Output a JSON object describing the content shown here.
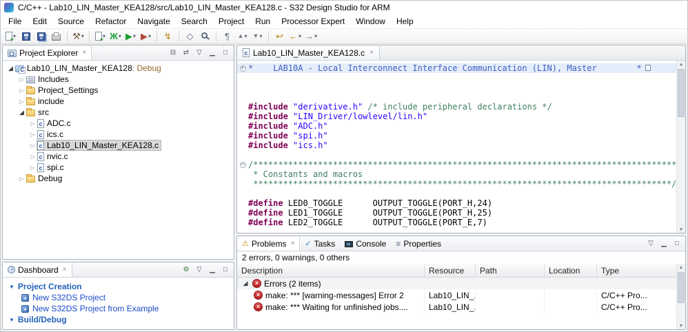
{
  "titlebar": {
    "title": "C/C++ - Lab10_LIN_Master_KEA128/src/Lab10_LIN_Master_KEA128.c - S32 Design Studio for ARM"
  },
  "menu": {
    "items": [
      "File",
      "Edit",
      "Source",
      "Refactor",
      "Navigate",
      "Search",
      "Project",
      "Run",
      "Processor Expert",
      "Window",
      "Help"
    ]
  },
  "icons": {
    "dropdown": "▾",
    "build": "⚒",
    "debug": "Ж",
    "run": "▶",
    "external_tools": "▶",
    "flash": "↯",
    "open_type": "◇",
    "paragraph": "¶",
    "prev_annotation": "▲",
    "next_annotation": "▼",
    "last_edit": "↩",
    "back": "←",
    "forward": "→",
    "collapse_all": "⊟",
    "link_editor": "⇄",
    "view_menu": "▽",
    "minimize": "▁",
    "maximize": "□",
    "close": "×",
    "gear": "⚙",
    "section_arrow": "▼",
    "tree_expanded": "◢",
    "tree_collapsed": "▷",
    "tasks": "✓",
    "properties": "≡",
    "problems": "⚠",
    "error_x": "×",
    "fold_plus": "+",
    "fold_minus": "−",
    "scroll_up": "▲",
    "scroll_down": "▼"
  },
  "explorer": {
    "tab": "Project Explorer",
    "root_name": "Lab10_LIN_Master_KEA128",
    "root_config": ": Debug",
    "nodes": {
      "includes": "Includes",
      "project_settings": "Project_Settings",
      "include": "include",
      "src": "src",
      "adc": "ADC.c",
      "ics": "ics.c",
      "main": "Lab10_LIN_Master_KEA128.c",
      "nvic": "nvic.c",
      "spi": "spi.c",
      "debug": "Debug"
    }
  },
  "dashboard": {
    "tab": "Dashboard",
    "project_creation": "Project Creation",
    "new_project": "New S32DS Project",
    "new_project_example": "New S32DS Project from Example",
    "build_debug": "Build/Debug"
  },
  "editor": {
    "tab": "Lab10_LIN_Master_KEA128.c",
    "code": {
      "header": "*    LAB10A - Local Interconnect Interface Communication (LIN), Master        *",
      "include_kw": "#include",
      "define_kw": "#define",
      "inc1_str": "\"derivative.h\"",
      "inc1_comment": "/* include peripheral declarations */",
      "inc2_str": "\"LIN_Driver/lowlevel/lin.h\"",
      "inc3_str": "\"ADC.h\"",
      "inc4_str": "\"spi.h\"",
      "inc5_str": "\"ics.h\"",
      "block_open": "/*************************************************************************************",
      "block_mid": " * Constants and macros",
      "block_close": " ************************************************************************************/",
      "def1_name": "LED0_TOGGLE",
      "def1_val": "OUTPUT_TOGGLE(PORT_H,24)",
      "def2_name": "LED1_TOGGLE",
      "def2_val": "OUTPUT_TOGGLE(PORT_H,25)",
      "def3_name": "LED2_TOGGLE",
      "def3_val": "OUTPUT_TOGGLE(PORT_E,7)"
    }
  },
  "problems": {
    "tab_problems": "Problems",
    "tab_tasks": "Tasks",
    "tab_console": "Console",
    "tab_properties": "Properties",
    "summary": "2 errors, 0 warnings, 0 others",
    "col_description": "Description",
    "col_resource": "Resource",
    "col_path": "Path",
    "col_location": "Location",
    "col_type": "Type",
    "group_label": "Errors (2 items)",
    "row1": {
      "description": "make: *** [warning-messages] Error 2",
      "resource": "Lab10_LIN_...",
      "path": "",
      "location": "",
      "type": "C/C++ Pro..."
    },
    "row2": {
      "description": "make: *** Waiting for unfinished jobs....",
      "resource": "Lab10_LIN_...",
      "path": "",
      "location": "",
      "type": "C/C++ Pro..."
    }
  }
}
